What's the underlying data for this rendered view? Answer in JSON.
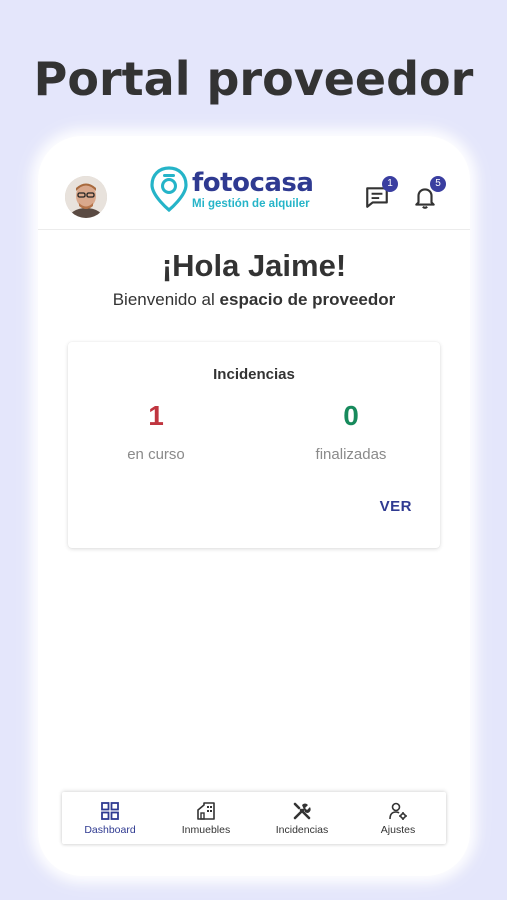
{
  "promo": {
    "title": "Portal proveedor"
  },
  "header": {
    "logo_text": "fotocasa",
    "logo_subtitle": "Mi gestión de alquiler",
    "messages_badge": "1",
    "notifications_badge": "5"
  },
  "greeting": {
    "title": "¡Hola Jaime!",
    "welcome_prefix": "Bienvenido al ",
    "welcome_bold": "espacio de proveedor"
  },
  "incidencias_card": {
    "title": "Incidencias",
    "in_progress_value": "1",
    "in_progress_label": "en curso",
    "finished_value": "0",
    "finished_label": "finalizadas",
    "action_label": "VER"
  },
  "bottom_nav": {
    "items": [
      {
        "label": "Dashboard",
        "icon": "dashboard-icon",
        "active": true
      },
      {
        "label": "Inmuebles",
        "icon": "building-icon",
        "active": false
      },
      {
        "label": "Incidencias",
        "icon": "tools-icon",
        "active": false
      },
      {
        "label": "Ajustes",
        "icon": "user-settings-icon",
        "active": false
      }
    ]
  },
  "colors": {
    "brand": "#2f3a91",
    "accent": "#25b4c8",
    "in_progress": "#c0353f",
    "finished": "#178a5c",
    "background": "#e4e6fb"
  }
}
